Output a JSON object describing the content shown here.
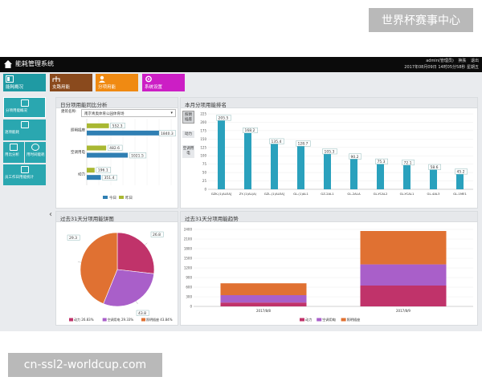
{
  "watermark": {
    "top": "世界杯赛事中心",
    "bottom": "cn-ssl2-worldcup.com"
  },
  "topbar": {
    "title": "能耗管理系统",
    "user": "admin(管理员)",
    "link_theme": "换肤",
    "link_logout": "退出",
    "datetime": "2017年08月09日 14时05分58秒 星期五"
  },
  "modules": [
    {
      "label": "能耗概况",
      "color": "#1f9aa3"
    },
    {
      "label": "支路用能",
      "color": "#8a4a1d"
    },
    {
      "label": "分项用能",
      "color": "#f08a12"
    },
    {
      "label": "系统设置",
      "color": "#cc1ec5"
    }
  ],
  "sidebar": [
    {
      "label": "分项用能概况"
    },
    {
      "label": "逐项能耗"
    },
    {
      "label": "用比分析"
    },
    {
      "label": "用时间能耗"
    },
    {
      "label": "员工作日用能统计"
    }
  ],
  "panels": {
    "daily": "日分项用能同比分析",
    "rank": "本月分项用能排名",
    "pie": "过去31天分项用能饼图",
    "trend": "过去31天分项用能趋势"
  },
  "filter": {
    "label": "建筑名称:",
    "value": "南京青奥体育公园体育场"
  },
  "rank_tabs": [
    "照明插座",
    "动力",
    "空调用电"
  ],
  "chart_data": [
    {
      "type": "bar",
      "orientation": "horizontal",
      "categories": [
        "照明插座",
        "空调用电",
        "动力"
      ],
      "series": [
        {
          "name": "今日",
          "color": "#2f7fb3",
          "values": [
            1840.3,
            1021.5,
            351.4
          ]
        },
        {
          "name": "昨日",
          "color": "#a9b832",
          "values": [
            552.3,
            482.6,
            196.1
          ]
        }
      ],
      "data_labels_today": [
        "1840.3",
        "1021.5",
        "351.4"
      ],
      "data_labels_yesterday": [
        "552.3",
        "482.6",
        "196.1"
      ],
      "xlim": [
        0,
        2100
      ],
      "legend": "bottom"
    },
    {
      "type": "bar",
      "categories": [
        "GZK-(1)ALEA]",
        "ZY-(1)AL(A)",
        "GZL-(1)ALEA]",
        "GL-(1)AL1",
        "GZ-2AL1",
        "GL-2ALA",
        "GL-YCAL2",
        "GL-YCAL1",
        "GL-4AL3",
        "GL-1ME1"
      ],
      "values": [
        205.5,
        168.2,
        135.4,
        128.7,
        105.3,
        90.2,
        75.3,
        72.1,
        58.6,
        45.2
      ],
      "data_labels": [
        "205.5",
        "168.2",
        "135.4",
        "128.7",
        "105.3",
        "90.2",
        "75.3",
        "72.1",
        "58.6",
        "45.2"
      ],
      "ylim": [
        0,
        225
      ],
      "yticks": [
        0,
        25,
        50,
        75,
        100,
        125,
        150,
        175,
        200,
        225
      ],
      "color": "#2aa1bd"
    },
    {
      "type": "pie",
      "slices": [
        {
          "name": "动力",
          "value": 26.83,
          "color": "#c0336a",
          "label": "26.83%"
        },
        {
          "name": "空调用电",
          "value": 29.33,
          "color": "#a95fc9",
          "label": "29.33%"
        },
        {
          "name": "照明插座",
          "value": 43.84,
          "color": "#e07132",
          "label": "43.84%"
        }
      ],
      "label_texts": [
        "26.8",
        "29.3",
        "43.8"
      ],
      "legend": "bottom"
    },
    {
      "type": "bar",
      "stacked": true,
      "categories": [
        "2017/8/8",
        "2017/8/9"
      ],
      "series": [
        {
          "name": "动力",
          "color": "#c0336a",
          "values": [
            120,
            650
          ]
        },
        {
          "name": "空调用电",
          "color": "#a95fc9",
          "values": [
            230,
            660
          ]
        },
        {
          "name": "照明插座",
          "color": "#e07132",
          "values": [
            370,
            1040
          ]
        }
      ],
      "ylim": [
        0,
        2400
      ],
      "yticks": [
        0,
        300,
        600,
        900,
        1200,
        1500,
        1800,
        2100,
        2400
      ],
      "legend": "bottom"
    }
  ]
}
